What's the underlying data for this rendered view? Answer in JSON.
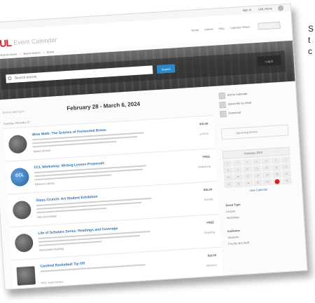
{
  "app": {
    "logo": "UL",
    "title": "Event Calendar"
  },
  "topbar": {
    "links": [
      "Sign In",
      "UofL Home"
    ]
  },
  "nav": [
    "Home",
    "Submit",
    "Help",
    "Calendar Views"
  ],
  "breadcrumbs": [
    "Events Home",
    "Event Search",
    "Event"
  ],
  "search": {
    "placeholder": "Search events",
    "button": "Search",
    "login": "Log in"
  },
  "main": {
    "view_option": "Events starting on",
    "date_range": "February 28 - March 6, 2024",
    "section": "Tuesday, February 27",
    "events": [
      {
        "title": "Wine Walk: The Science of Fermented Brews",
        "meta": "Speed School",
        "price": "$15.00",
        "tag": "Lecture",
        "thumb": ""
      },
      {
        "title": "CCL Workshop: Writing Lesson Proposals",
        "meta": "Ekstrom Library",
        "price": "FREE",
        "tag": "Workshop",
        "thumb": "CCL"
      },
      {
        "title": "Glass Crunch: Art Student Exhibition",
        "meta": "Hite Art Institute",
        "price": "$25.00",
        "tag": "Exhibit",
        "thumb": ""
      },
      {
        "title": "Life of Scholars Series: Readings and Coverage",
        "meta": "Humanities Building",
        "price": "FREE",
        "tag": "Reading",
        "thumb": ""
      },
      {
        "title": "Cardinal Basketball Tip Off",
        "meta": "KFC Yum! Center",
        "price": "$10.00",
        "tag": "Athletics",
        "thumb": ""
      }
    ]
  },
  "sidebar": {
    "links": [
      "Add to Calendar",
      "Subscribe by email",
      "Download"
    ],
    "box": "Upcoming Events",
    "calendar": {
      "month": "February 2024",
      "days": [
        "1",
        "2",
        "3",
        "4",
        "5",
        "6",
        "7",
        "8",
        "9",
        "10",
        "11",
        "12",
        "13",
        "14",
        "15",
        "16",
        "17",
        "18",
        "19",
        "20",
        "21",
        "22",
        "23",
        "24",
        "25",
        "26",
        "27",
        "28"
      ],
      "today": "27",
      "footer": "View Calendar"
    },
    "sections": [
      {
        "title": "Event Type",
        "items": [
          "Lecture",
          "Workshop"
        ]
      },
      {
        "title": "Audience",
        "items": [
          "Students",
          "Faculty and Staff"
        ]
      }
    ]
  },
  "edge": {
    "lines": [
      "S",
      "t",
      "c"
    ]
  }
}
